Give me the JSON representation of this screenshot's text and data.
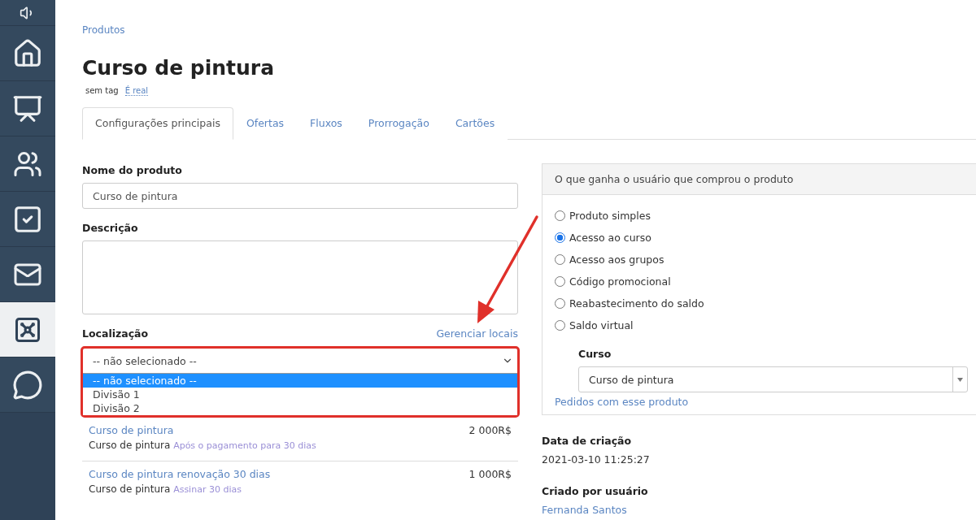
{
  "sidebar": {
    "items": [
      {
        "kind": "speaker",
        "selected": false
      },
      {
        "kind": "home",
        "selected": false
      },
      {
        "kind": "chart",
        "selected": false
      },
      {
        "kind": "people",
        "selected": false
      },
      {
        "kind": "checkbox",
        "selected": false
      },
      {
        "kind": "mail",
        "selected": false
      },
      {
        "kind": "safe",
        "selected": true
      },
      {
        "kind": "chat",
        "selected": false
      }
    ]
  },
  "breadcrumb": "Produtos",
  "title": "Curso de pintura",
  "tag": "sem tag",
  "tag_link": "É real",
  "tabs": [
    {
      "label": "Configurações principais",
      "selected": true
    },
    {
      "label": "Ofertas",
      "selected": false
    },
    {
      "label": "Fluxos",
      "selected": false
    },
    {
      "label": "Prorrogação",
      "selected": false
    },
    {
      "label": "Cartões",
      "selected": false
    }
  ],
  "name_field": {
    "label": "Nome do produto",
    "value": "Curso de pintura"
  },
  "description_field": {
    "label": "Descrição"
  },
  "location": {
    "label": "Localização",
    "manage_link": "Gerenciar locais",
    "value": "-- não selecionado --",
    "options": [
      {
        "label": "-- não selecionado --",
        "selected": true
      },
      {
        "label": "Divisão 1",
        "selected": false
      },
      {
        "label": "Divisão 2",
        "selected": false
      }
    ]
  },
  "offers": [
    {
      "name": "Curso de pintura",
      "price": "2 000R$",
      "product": "Curso de pintura",
      "period": "Após o pagamento para 30 dias"
    },
    {
      "name": "Curso de pintura renovação 30 dias",
      "price": "1 000R$",
      "product": "Curso de pintura",
      "period": "Assinar 30 dias"
    }
  ],
  "benefit_panel": {
    "title": "O que ganha o usuário que comprou o produto",
    "options": [
      {
        "label": "Produto simples",
        "selected": false
      },
      {
        "label": "Acesso ao curso",
        "selected": true
      },
      {
        "label": "Acesso aos grupos",
        "selected": false
      },
      {
        "label": "Código promocional",
        "selected": false
      },
      {
        "label": "Reabastecimento do saldo",
        "selected": false
      },
      {
        "label": "Saldo virtual",
        "selected": false
      }
    ],
    "course_label": "Curso",
    "course_value": "Curso de pintura",
    "orders_link": "Pedidos com esse produto"
  },
  "created": {
    "label": "Data de criação",
    "value": "2021-03-10 11:25:27"
  },
  "creator": {
    "label": "Criado por usuário",
    "value": "Fernanda Santos"
  }
}
